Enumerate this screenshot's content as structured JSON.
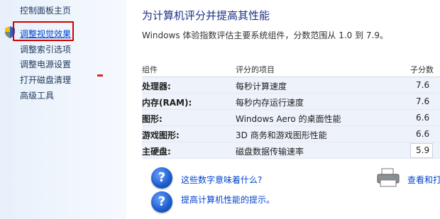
{
  "nav": {
    "home": "控制面板主页",
    "items": [
      "调整视觉效果",
      "调整索引选项",
      "调整电源设置",
      "打开磁盘清理",
      "高级工具"
    ]
  },
  "main": {
    "title": "为计算机评分并提高其性能",
    "subtitle": "Windows 体验指数评估主要系统组件，分数范围从 1.0 到 7.9。",
    "table": {
      "headers": [
        "组件",
        "评分的项目",
        "子分数"
      ],
      "rows": [
        {
          "component": "处理器:",
          "item": "每秒计算速度",
          "score": "7.6"
        },
        {
          "component": "内存(RAM):",
          "item": "每秒内存运行速度",
          "score": "7.6"
        },
        {
          "component": "图形:",
          "item": "Windows Aero 的桌面性能",
          "score": "6.6"
        },
        {
          "component": "游戏图形:",
          "item": "3D 商务和游戏图形性能",
          "score": "6.6"
        },
        {
          "component": "主硬盘:",
          "item": "磁盘数据传输速率",
          "score": "5.9"
        }
      ]
    },
    "help_links": [
      "这些数字意味着什么?",
      "提高计算机性能的提示。"
    ],
    "print_link": "查看和打印"
  },
  "colors": {
    "highlight": "#d40000",
    "link": "#0044cc",
    "title": "#1e3287"
  },
  "icons": {
    "nav_shield": "shield-icon",
    "help": "help-question-icon",
    "printer": "printer-icon"
  }
}
